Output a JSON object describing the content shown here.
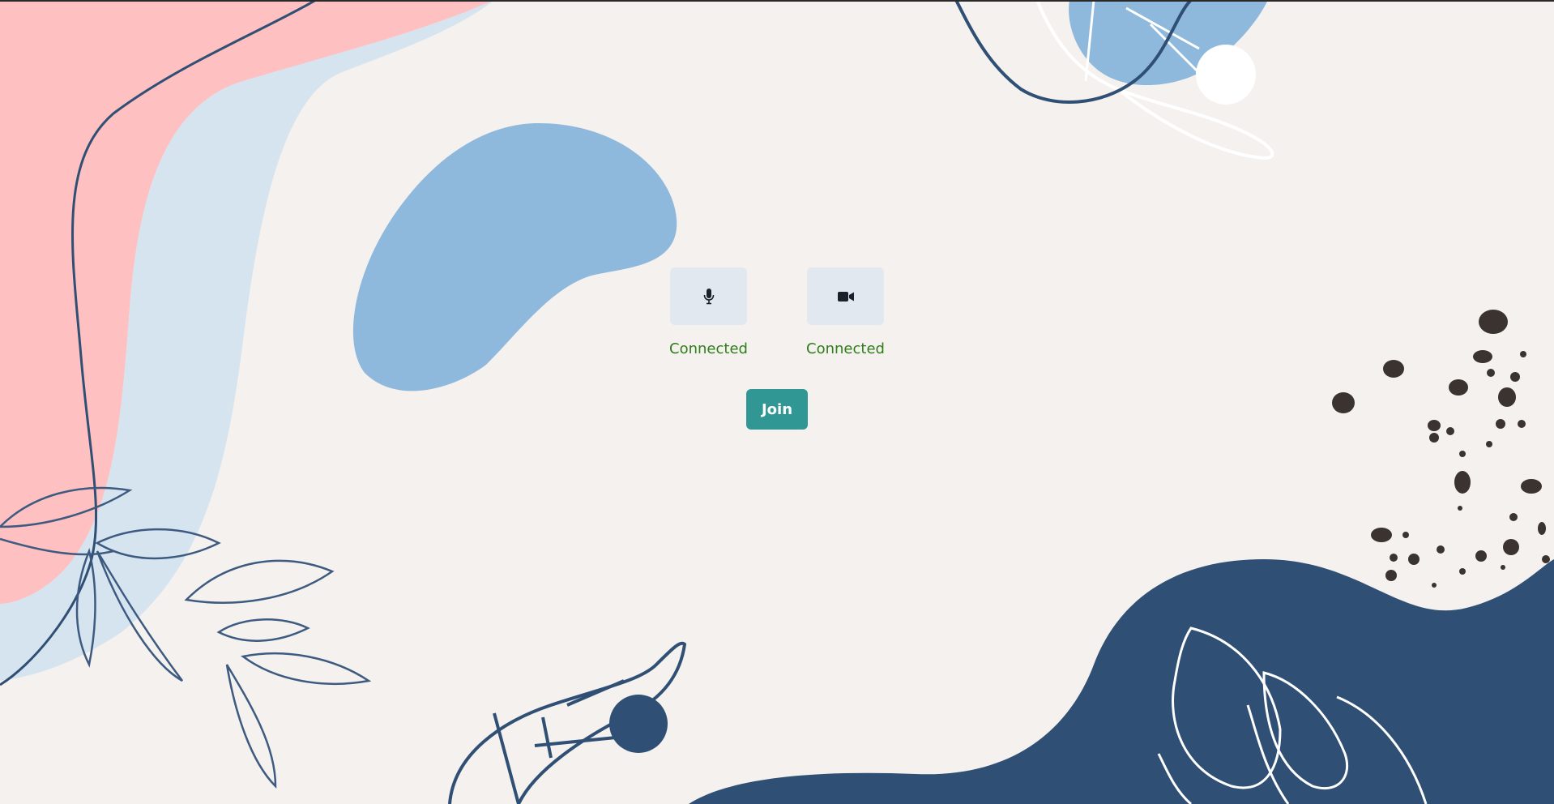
{
  "devices": {
    "microphone": {
      "icon": "microphone-icon",
      "status": "Connected"
    },
    "camera": {
      "icon": "video-camera-icon",
      "status": "Connected"
    }
  },
  "join_button": {
    "label": "Join"
  },
  "colors": {
    "background": "#f5f1ee",
    "status_text": "#2f7d1b",
    "join_button": "#319795",
    "device_button": "#e2e8f0",
    "navy": "#2f4f75",
    "pink": "#fec0c0",
    "light_blue": "#d6e4f0",
    "blue": "#8fb9dc",
    "dark_dots": "#3b3330"
  }
}
